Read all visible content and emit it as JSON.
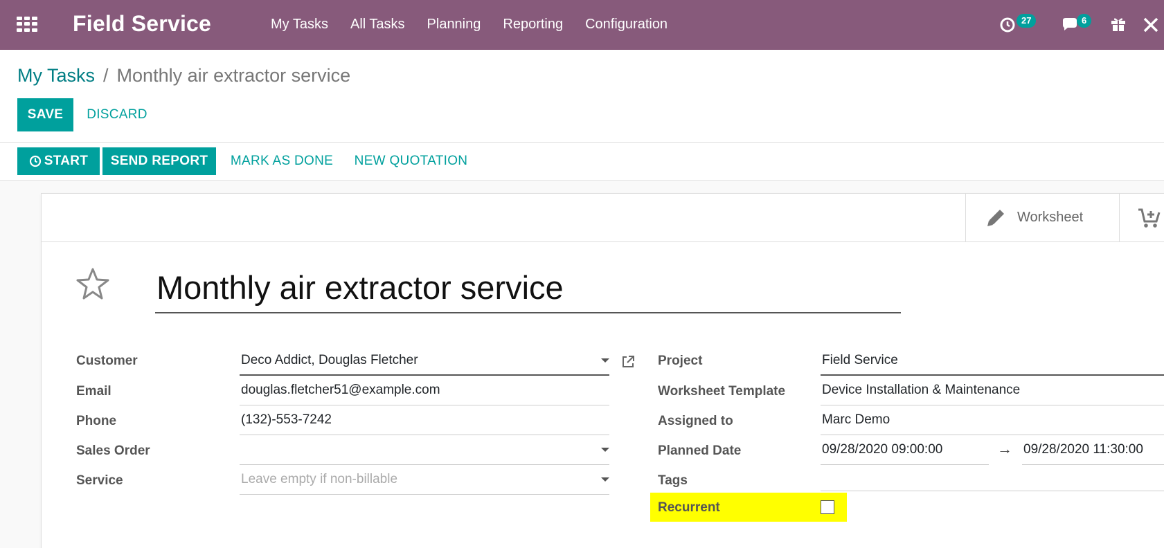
{
  "navbar": {
    "app_title": "Field Service",
    "menu": [
      "My Tasks",
      "All Tasks",
      "Planning",
      "Reporting",
      "Configuration"
    ],
    "activity_count": "27",
    "message_count": "6"
  },
  "control_panel": {
    "breadcrumb_parent": "My Tasks",
    "breadcrumb_separator": "/",
    "breadcrumb_current": "Monthly air extractor service",
    "save_label": "SAVE",
    "discard_label": "DISCARD"
  },
  "statusbar": {
    "start_label": "START",
    "send_report_label": "SEND REPORT",
    "mark_done_label": "MARK AS DONE",
    "new_quotation_label": "NEW QUOTATION"
  },
  "sheet": {
    "worksheet_label": "Worksheet",
    "task_title": "Monthly air extractor service",
    "left_fields": [
      {
        "label": "Customer",
        "value": "Deco Addict, Douglas Fletcher"
      },
      {
        "label": "Email",
        "value": "douglas.fletcher51@example.com"
      },
      {
        "label": "Phone",
        "value": "(132)-553-7242"
      },
      {
        "label": "Sales Order",
        "value": ""
      },
      {
        "label": "Service",
        "placeholder": "Leave empty if non-billable"
      }
    ],
    "right_fields": [
      {
        "label": "Project",
        "value": "Field Service"
      },
      {
        "label": "Worksheet Template",
        "value": "Device Installation & Maintenance"
      },
      {
        "label": "Assigned to",
        "value": "Marc Demo"
      },
      {
        "label": "Planned Date",
        "start": "09/28/2020 09:00:00",
        "arrow": "→",
        "end": "09/28/2020 11:30:00"
      },
      {
        "label": "Tags",
        "value": ""
      },
      {
        "label": "Recurrent",
        "checked": false
      }
    ]
  },
  "colors": {
    "navbar": "#875a7b",
    "primary": "#00a09d",
    "highlight": "#ffff00"
  }
}
